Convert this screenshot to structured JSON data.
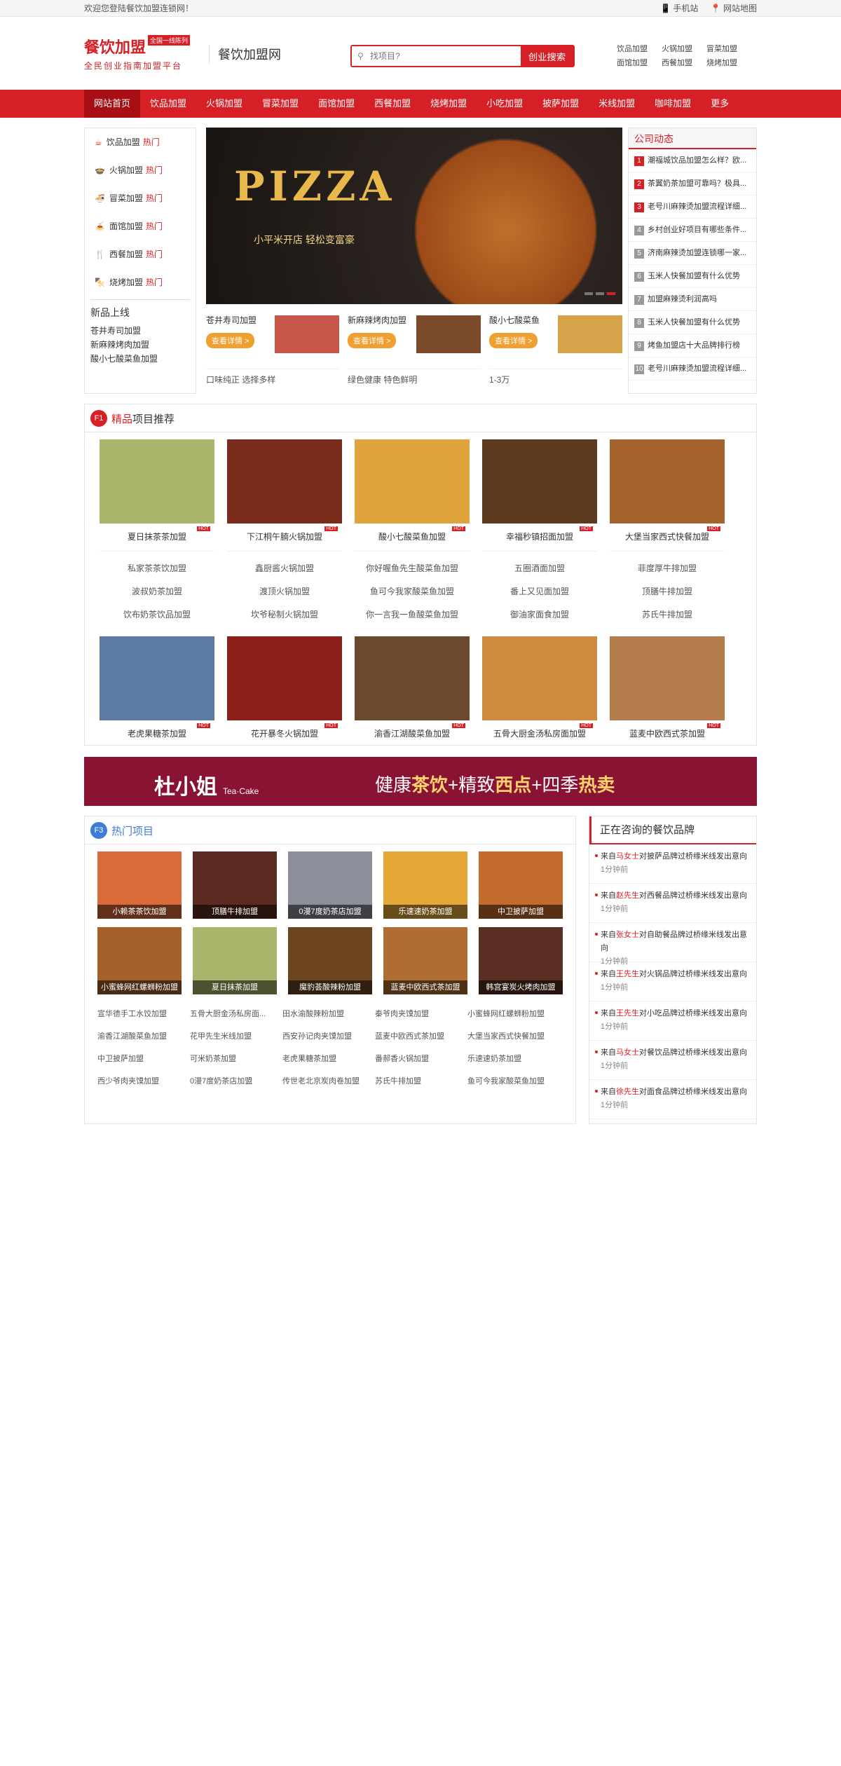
{
  "topbar": {
    "welcome": "欢迎您登陆餐饮加盟连锁网！",
    "mobile": "手机站",
    "sitemap": "网站地图"
  },
  "header": {
    "logo": "餐饮加盟",
    "logo_tag": "全国一线陈列",
    "slogan": "全民创业指南加盟平台",
    "sitename": "餐饮加盟网"
  },
  "search": {
    "placeholder": "找项目?",
    "button": "创业搜索"
  },
  "hot_links": [
    "饮品加盟",
    "火锅加盟",
    "冒菜加盟",
    "面馆加盟",
    "西餐加盟",
    "烧烤加盟"
  ],
  "nav": [
    "网站首页",
    "饮品加盟",
    "火锅加盟",
    "冒菜加盟",
    "面馆加盟",
    "西餐加盟",
    "烧烤加盟",
    "小吃加盟",
    "披萨加盟",
    "米线加盟",
    "咖啡加盟",
    "更多"
  ],
  "side": {
    "items": [
      {
        "label": "饮品加盟"
      },
      {
        "label": "火锅加盟"
      },
      {
        "label": "冒菜加盟"
      },
      {
        "label": "面馆加盟"
      },
      {
        "label": "西餐加盟"
      },
      {
        "label": "烧烤加盟"
      }
    ],
    "hot": "热门",
    "new_title": "新品上线",
    "new_items": [
      "苍井寿司加盟",
      "新麻辣烤肉加盟",
      "酸小七酸菜鱼加盟"
    ]
  },
  "banner": {
    "title": "PIZZA",
    "subtitle": "小平米开店 轻松变富豪"
  },
  "cards": [
    {
      "title": "苍井寿司加盟",
      "btn": "查看详情 >",
      "desc": "口味纯正 选择多样"
    },
    {
      "title": "新麻辣烤肉加盟",
      "btn": "查看详情 >",
      "desc": "绿色健康 特色鲜明"
    },
    {
      "title": "酸小七酸菜鱼",
      "btn": "查看详情 >",
      "desc": "1-3万"
    }
  ],
  "company_news": {
    "title": "公司动态",
    "items": [
      "潮福城饮品加盟怎么样？欧...",
      "茶翼奶茶加盟可靠吗？极具...",
      "老号川麻辣烫加盟流程详细...",
      "乡村创业好项目有哪些条件...",
      "济南麻辣烫加盟连锁哪一家...",
      "玉米人快餐加盟有什么优势",
      "加盟麻辣烫利润高吗",
      "玉米人快餐加盟有什么优势",
      "烤鱼加盟店十大品牌排行榜",
      "老号川麻辣烫加盟流程详细..."
    ]
  },
  "featured": {
    "flag": "F1",
    "title_em": "精品",
    "title": "项目推荐",
    "hot_badge": "HOT",
    "cols": [
      {
        "name": "夏日抹茶茶加盟",
        "links": [
          "私家茶茶饮加盟",
          "波叔奶茶加盟",
          "饮布奶茶饮品加盟"
        ],
        "color": "#a9b56b"
      },
      {
        "name": "下江桐午腩火锅加盟",
        "links": [
          "鑫厨酱火锅加盟",
          "渡顶火锅加盟",
          "坎爷秘制火锅加盟"
        ],
        "color": "#7a2c1c"
      },
      {
        "name": "酸小七酸菜鱼加盟",
        "links": [
          "你好喔鱼先生酸菜鱼加盟",
          "鱼可今我家酸菜鱼加盟",
          "你一言我一鱼酸菜鱼加盟"
        ],
        "color": "#e0a23a"
      },
      {
        "name": "幸福秒镇招面加盟",
        "links": [
          "五圈酒面加盟",
          "番上又见面加盟",
          "御油家面食加盟"
        ],
        "color": "#5b3a1e"
      },
      {
        "name": "大堡当家西式快餐加盟",
        "links": [
          "菲度厚牛排加盟",
          "顶膳牛排加盟",
          "苏氏牛排加盟"
        ],
        "color": "#a5632c"
      }
    ],
    "row2": [
      {
        "name": "老虎果糖茶加盟",
        "color": "#5d7aa3"
      },
      {
        "name": "花开暴冬火锅加盟",
        "color": "#8b1f1a"
      },
      {
        "name": "渝香江湖酸菜鱼加盟",
        "color": "#6a4a2c"
      },
      {
        "name": "五骨大厨金汤私房面加盟",
        "color": "#d08a3e"
      },
      {
        "name": "蓝麦中欧西式茶加盟",
        "color": "#b47b4d"
      }
    ]
  },
  "ad": {
    "brand": "杜小姐",
    "brand_sub": "Tea·Cake",
    "slogan_a": "健康",
    "slogan_b": "茶饮",
    "slogan_c": "+精致",
    "slogan_d": "西点",
    "slogan_e": "+四季",
    "slogan_f": "热卖"
  },
  "hot_projects": {
    "flag": "F3",
    "title": "热门项目",
    "tiles": [
      {
        "name": "小赖茶茶饮加盟",
        "color": "#d96a3a"
      },
      {
        "name": "顶膳牛排加盟",
        "color": "#5b2a20"
      },
      {
        "name": "0漫7度奶茶店加盟",
        "color": "#8a8f9a"
      },
      {
        "name": "乐速速奶茶加盟",
        "color": "#e5a838"
      },
      {
        "name": "中卫披萨加盟",
        "color": "#c46a2c"
      },
      {
        "name": "小蜜蜂网红螺蛳粉加盟",
        "color": "#a5612a"
      },
      {
        "name": "夏日抹茶加盟",
        "color": "#a9b56b"
      },
      {
        "name": "魔豹荟酸辣粉加盟",
        "color": "#6c4520"
      },
      {
        "name": "蓝麦中欧西式茶加盟",
        "color": "#b06d32"
      },
      {
        "name": "韩宫宴炭火烤肉加盟",
        "color": "#5a2e22"
      }
    ],
    "links": [
      "宣华德手工水饺加盟",
      "五骨大厨金汤私房面...",
      "田水渝酸辣粉加盟",
      "秦爷肉夹馍加盟",
      "小蜜蜂网红螺蛳粉加盟",
      "渝香江湖酸菜鱼加盟",
      "花甲先生米线加盟",
      "西安孙记肉夹馍加盟",
      "蓝麦中欧西式茶加盟",
      "大堡当家西式快餐加盟",
      "中卫披萨加盟",
      "可米奶茶加盟",
      "老虎果糖茶加盟",
      "番郝香火锅加盟",
      "乐速速奶茶加盟",
      "西少爷肉夹馍加盟",
      "0漫7度奶茶店加盟",
      "传世老北京炭肉卷加盟",
      "苏氏牛排加盟",
      "鱼可今我家酸菜鱼加盟"
    ]
  },
  "consulting": {
    "title": "正在咨询的餐饮品牌",
    "items": [
      {
        "pre": "来自",
        "who": "马女士",
        "text": "对披萨品牌过桥缘米线发出意向",
        "time": "1分钟前"
      },
      {
        "pre": "来自",
        "who": "赵先生",
        "text": "对西餐品牌过桥缘米线发出意向",
        "time": "1分钟前"
      },
      {
        "pre": "来自",
        "who": "张女士",
        "text": "对自助餐品牌过桥缘米线发出意向",
        "time": "1分钟前"
      },
      {
        "pre": "来自",
        "who": "王先生",
        "text": "对火锅品牌过桥缘米线发出意向",
        "time": "1分钟前"
      },
      {
        "pre": "来自",
        "who": "王先生",
        "text": "对小吃品牌过桥缘米线发出意向",
        "time": "1分钟前"
      },
      {
        "pre": "来自",
        "who": "马女士",
        "text": "对餐饮品牌过桥缘米线发出意向",
        "time": "1分钟前"
      },
      {
        "pre": "来自",
        "who": "徐先生",
        "text": "对面食品牌过桥缘米线发出意向",
        "time": "1分钟前"
      }
    ]
  },
  "colors": {
    "brand": "#d71f26",
    "accent": "#3f7cd6",
    "button": "#f0a030"
  }
}
